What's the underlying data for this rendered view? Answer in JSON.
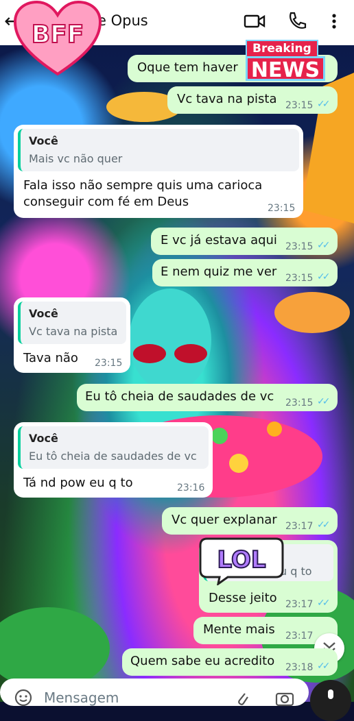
{
  "header": {
    "contact_name_partial": "e Opus",
    "sticker_text": "BFF"
  },
  "stickers": {
    "breaking_top": "Breaking",
    "breaking_bottom": "NEWS",
    "lol": "LOL"
  },
  "messages": [
    {
      "dir": "out",
      "text": "Oque tem haver",
      "time": ""
    },
    {
      "dir": "out",
      "text": "Vc tava na pista",
      "time": "23:15"
    },
    {
      "dir": "in",
      "quote_author": "Você",
      "quote_text": "Mais vc não quer",
      "text1": "Fala isso não sempre quis uma carioca",
      "text2": "conseguir com fé em Deus",
      "time": "23:15"
    },
    {
      "dir": "out",
      "text": "E vc já estava aqui",
      "time": "23:15"
    },
    {
      "dir": "out",
      "text": "E nem quiz me ver",
      "time": "23:15"
    },
    {
      "dir": "in",
      "quote_author": "Você",
      "quote_text": "Vc tava na pista",
      "text": "Tava não",
      "time": "23:15"
    },
    {
      "dir": "out",
      "text": "Eu tô cheia de saudades de vc",
      "time": "23:15"
    },
    {
      "dir": "in",
      "quote_author": "Você",
      "quote_text": "Eu tô cheia de saudades de vc",
      "text": "Tá nd pow eu q to",
      "time": "23:16"
    },
    {
      "dir": "out",
      "text": "Vc quer explanar",
      "time": "23:17"
    },
    {
      "dir": "out",
      "quote_text": "u q to",
      "text": "Desse jeito",
      "time": "23:17"
    },
    {
      "dir": "out",
      "text": "Mente mais",
      "time": "23:17"
    },
    {
      "dir": "out",
      "text": "Quem sabe eu acredito",
      "time": "23:18"
    }
  ],
  "composer": {
    "placeholder": "Mensagem"
  },
  "ticks": "✓✓"
}
